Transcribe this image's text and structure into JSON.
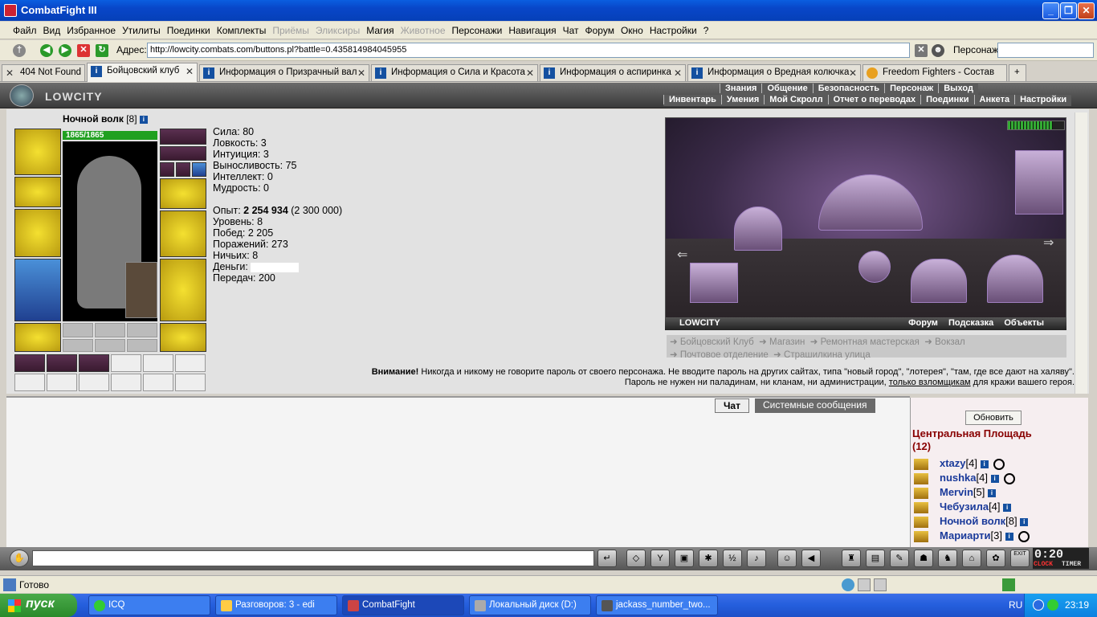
{
  "window": {
    "title": "CombatFight III"
  },
  "menu": [
    "Файл",
    "Вид",
    "Избранное",
    "Утилиты",
    "Поединки",
    "Комплекты",
    "Приёмы",
    "Эликсиры",
    "Магия",
    "Животное",
    "Персонажи",
    "Навигация",
    "Чат",
    "Форум",
    "Окно",
    "Настройки",
    "?"
  ],
  "menu_disabled": [
    false,
    false,
    false,
    false,
    false,
    false,
    true,
    true,
    false,
    true,
    false,
    false,
    false,
    false,
    false,
    false,
    false
  ],
  "address": {
    "label": "Адрес:",
    "url": "http://lowcity.combats.com/buttons.pl?battle=0.435814984045955",
    "persona_label": "Персонаж:"
  },
  "tabs": [
    "404 Not Found",
    "Бойцовский клуб",
    "Информация о Призрачный вал",
    "Информация о Сила и Красота",
    "Информация о аспиринка",
    "Информация о Вредная колючка",
    "Freedom Fighters - Состав"
  ],
  "game_nav": {
    "row1": [
      "Знания",
      "Общение",
      "Безопасность",
      "Персонаж",
      "Выход"
    ],
    "row2": [
      "Инвентарь",
      "Умения",
      "Мой Скролл",
      "Отчет о переводах",
      "Поединки",
      "Анкета",
      "Настройки"
    ],
    "logo": "LOWCITY"
  },
  "character": {
    "name": "Ночной волк",
    "level": "[8]",
    "hp": "1865/1865"
  },
  "stats": {
    "strength": "Сила: 80",
    "agility": "Ловкость: 3",
    "intuition": "Интуиция: 3",
    "endurance": "Выносливость: 75",
    "intellect": "Интеллект: 0",
    "wisdom": "Мудрость: 0",
    "exp_label": "Опыт: ",
    "exp_value": "2 254 934",
    "exp_next": " (2 300 000)",
    "level": "Уровень: 8",
    "wins": "Побед: 2 205",
    "losses": "Поражений: 273",
    "draws": "Ничьих: 8",
    "money": "Деньги: ",
    "transfers": "Передач: 200"
  },
  "scene": {
    "title": "LOWCITY",
    "links": [
      "Форум",
      "Подсказка",
      "Объекты"
    ]
  },
  "exits": {
    "row1": [
      "Бойцовский Клуб",
      "Магазин",
      "Ремонтная мастерская",
      "Вокзал"
    ],
    "row2": [
      "Почтовое отделение",
      "Страшилкина улица"
    ]
  },
  "warning": {
    "bold": "Внимание!",
    "text": " Никогда и никому не говорите пароль от своего персонажа. Не вводите пароль на других сайтах, типа \"новый город\", \"лотерея\", \"там, где все дают на халяву\". Пароль не нужен ни паладинам, ни кланам, ни администрации, ",
    "link": "только взломщикам",
    "tail": " для кражи вашего героя."
  },
  "chat": {
    "tab_chat": "Чат",
    "tab_system": "Системные сообщения"
  },
  "online": {
    "refresh": "Обновить",
    "room": "Центральная Площадь",
    "count": "(12)",
    "users": [
      {
        "name": "xtazy",
        "level": "[4]"
      },
      {
        "name": "nushka",
        "level": "[4]"
      },
      {
        "name": "Mervin",
        "level": "[5]"
      },
      {
        "name": "Чебузила",
        "level": "[4]"
      },
      {
        "name": "Ночной волк",
        "level": "[8]"
      },
      {
        "name": "Мариарти",
        "level": "[3]"
      }
    ]
  },
  "clock": {
    "time": "0:20",
    "clock_label": "CLOCK",
    "timer_label": "TIMER",
    "exit_label": "EXIT"
  },
  "statusbar": {
    "text": "Готово"
  },
  "taskbar": {
    "start": "пуск",
    "items": [
      "ICQ",
      "Разговоров: 3 - edi",
      "CombatFight",
      "Локальный диск (D:)",
      "jackass_number_two..."
    ],
    "lang": "RU",
    "time": "23:19"
  }
}
